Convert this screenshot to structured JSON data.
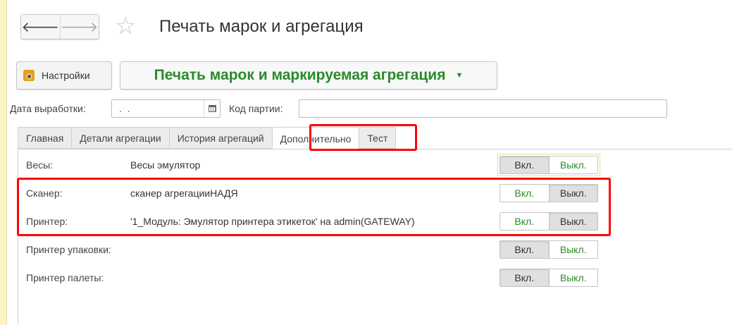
{
  "header": {
    "back_icon": "arrow-left-icon",
    "forward_icon": "arrow-right-icon",
    "favorite_icon": "star-outline-icon",
    "title": "Печать марок и агрегация"
  },
  "toolbar": {
    "settings_label": "Настройки",
    "settings_icon": "gear-icon",
    "mode_label": "Печать марок и маркируемая агрегация",
    "mode_color": "#2a8a2a"
  },
  "fields": {
    "date_label": "Дата выработки:",
    "date_value": ".  .",
    "batch_label": "Код партии:",
    "batch_value": ""
  },
  "tabs": [
    {
      "label": "Главная"
    },
    {
      "label": "Детали агрегации"
    },
    {
      "label": "История агрегаций"
    },
    {
      "label": "Дополнительно"
    },
    {
      "label": "Тест"
    }
  ],
  "devices": [
    {
      "label": "Весы:",
      "value": "Весы эмулятор",
      "on": "Вкл.",
      "off": "Выкл.",
      "state": "off"
    },
    {
      "label": "Сканер:",
      "value": "сканер агрегацииНАДЯ",
      "on": "Вкл.",
      "off": "Выкл.",
      "state": "on"
    },
    {
      "label": "Принтер:",
      "value": "'1_Модуль: Эмулятор принтера этикеток' на admin(GATEWAY)",
      "on": "Вкл.",
      "off": "Выкл.",
      "state": "on"
    },
    {
      "label": "Принтер упаковки:",
      "value": "",
      "on": "Вкл.",
      "off": "Выкл.",
      "state": "off"
    },
    {
      "label": "Принтер палеты:",
      "value": "",
      "on": "Вкл.",
      "off": "Выкл.",
      "state": "off"
    }
  ],
  "highlight_color": "#ff0000"
}
